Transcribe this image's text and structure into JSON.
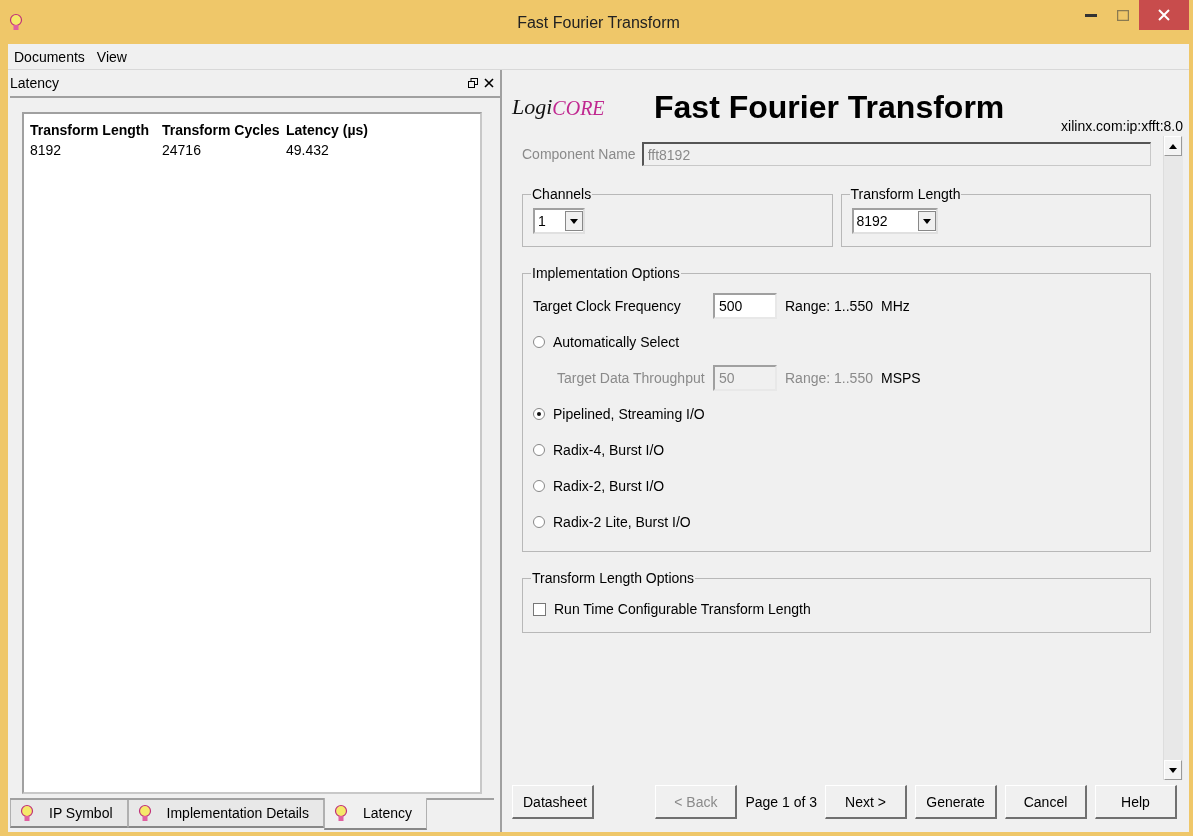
{
  "window": {
    "title": "Fast Fourier Transform"
  },
  "menu": [
    {
      "label": "Documents"
    },
    {
      "label": "View"
    }
  ],
  "left_panel": {
    "title": "Latency",
    "table": {
      "columns": [
        "Transform Length",
        "Transform Cycles",
        "Latency (µs)"
      ],
      "rows": [
        [
          "8192",
          "24716",
          "49.432"
        ]
      ]
    },
    "tabs": [
      {
        "label": "IP Symbol",
        "selected": false
      },
      {
        "label": "Implementation Details",
        "selected": false
      },
      {
        "label": "Latency",
        "selected": true
      }
    ]
  },
  "header": {
    "logo": {
      "prefix": "Logi",
      "suffix": "CORE"
    },
    "title": "Fast Fourier Transform",
    "vlnv": "xilinx.com:ip:xfft:8.0"
  },
  "component_name": {
    "label": "Component Name",
    "value": "fft8192",
    "disabled": true
  },
  "selectors": [
    {
      "title": "Channels",
      "value": "1"
    },
    {
      "title": "Transform Length",
      "value": "8192"
    }
  ],
  "implementation_options": {
    "title": "Implementation Options",
    "rows": [
      {
        "kind": "field",
        "label": "Target Clock Frequency",
        "value": "500",
        "range": "Range: 1..550",
        "unit": "MHz",
        "disabled": false
      },
      {
        "kind": "radio",
        "label": "Automatically Select",
        "selected": false
      },
      {
        "kind": "field",
        "label": "Target Data Throughput",
        "value": "50",
        "range": "Range: 1..550",
        "unit": "MSPS",
        "disabled": true
      },
      {
        "kind": "radio",
        "label": "Pipelined, Streaming I/O",
        "selected": true
      },
      {
        "kind": "radio",
        "label": "Radix-4, Burst I/O",
        "selected": false
      },
      {
        "kind": "radio",
        "label": "Radix-2, Burst I/O",
        "selected": false
      },
      {
        "kind": "radio",
        "label": "Radix-2 Lite, Burst I/O",
        "selected": false
      }
    ]
  },
  "transform_length_options": {
    "title": "Transform Length Options",
    "checkbox": {
      "label": "Run Time Configurable Transform Length",
      "checked": false
    }
  },
  "footer": [
    {
      "kind": "button",
      "label": "Datasheet",
      "disabled": false
    },
    {
      "kind": "spacer"
    },
    {
      "kind": "button",
      "label": "< Back",
      "disabled": true
    },
    {
      "kind": "text",
      "label": "Page 1 of 3"
    },
    {
      "kind": "button",
      "label": "Next >",
      "disabled": false
    },
    {
      "kind": "button",
      "label": "Generate",
      "disabled": false
    },
    {
      "kind": "button",
      "label": "Cancel",
      "disabled": false
    },
    {
      "kind": "button",
      "label": "Help",
      "disabled": false
    }
  ]
}
